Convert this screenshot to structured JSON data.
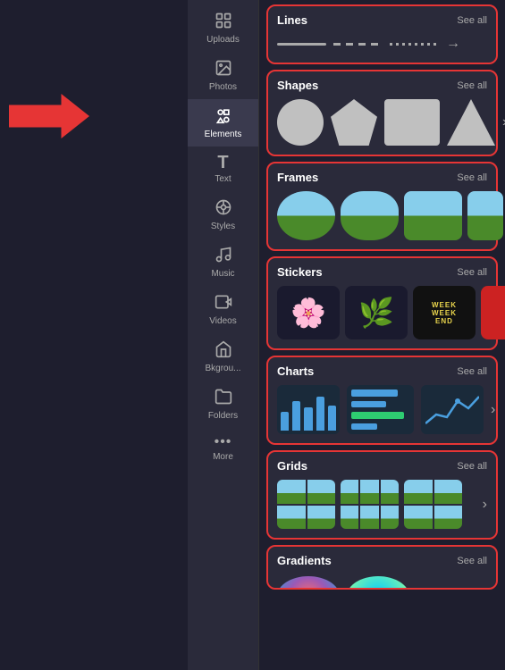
{
  "sidebar": {
    "items": [
      {
        "id": "uploads",
        "label": "Uploads",
        "icon": "⬆"
      },
      {
        "id": "photos",
        "label": "Photos",
        "icon": "🖼"
      },
      {
        "id": "elements",
        "label": "Elements",
        "icon": "✦",
        "active": true
      },
      {
        "id": "text",
        "label": "Text",
        "icon": "T"
      },
      {
        "id": "styles",
        "label": "Styles",
        "icon": "✿"
      },
      {
        "id": "music",
        "label": "Music",
        "icon": "♪"
      },
      {
        "id": "videos",
        "label": "Videos",
        "icon": "▶"
      },
      {
        "id": "bkgrou",
        "label": "Bkgrou...",
        "icon": "⊞"
      },
      {
        "id": "folders",
        "label": "Folders",
        "icon": "📁"
      },
      {
        "id": "more",
        "label": "More",
        "icon": "•••"
      }
    ]
  },
  "sections": [
    {
      "id": "lines",
      "title": "Lines",
      "see_all_label": "See all"
    },
    {
      "id": "shapes",
      "title": "Shapes",
      "see_all_label": "See all"
    },
    {
      "id": "frames",
      "title": "Frames",
      "see_all_label": "See all"
    },
    {
      "id": "stickers",
      "title": "Stickers",
      "see_all_label": "See all"
    },
    {
      "id": "charts",
      "title": "Charts",
      "see_all_label": "See all"
    },
    {
      "id": "grids",
      "title": "Grids",
      "see_all_label": "See all"
    },
    {
      "id": "gradients",
      "title": "Gradients",
      "see_all_label": "See all"
    }
  ],
  "charts": {
    "bars": [
      30,
      50,
      40,
      55,
      45
    ],
    "horiz_bars": [
      {
        "width": "80%",
        "color": "#4a9fdf"
      },
      {
        "width": "60%",
        "color": "#4a9fdf"
      },
      {
        "width": "90%",
        "color": "#2ecc71"
      },
      {
        "width": "45%",
        "color": "#4a9fdf"
      }
    ]
  }
}
